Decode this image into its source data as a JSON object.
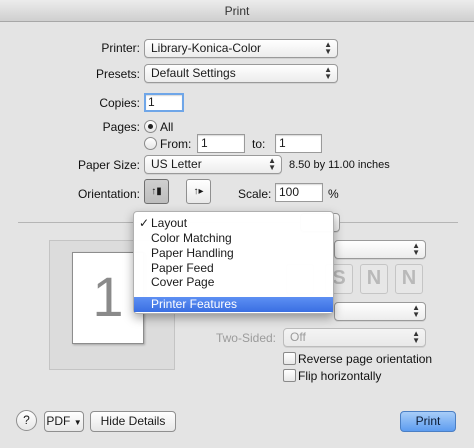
{
  "window": {
    "title": "Print"
  },
  "printer": {
    "label": "Printer:",
    "value": "Library-Konica-Color"
  },
  "presets": {
    "label": "Presets:",
    "value": "Default Settings"
  },
  "copies": {
    "label": "Copies:",
    "value": "1"
  },
  "pages": {
    "label": "Pages:",
    "all_label": "All",
    "from_label": "From:",
    "from_value": "1",
    "to_label": "to:",
    "to_value": "1"
  },
  "paper_size": {
    "label": "Paper Size:",
    "value": "US Letter",
    "dimensions": "8.50 by 11.00 inches"
  },
  "orientation": {
    "label": "Orientation:",
    "portrait_glyph": "↑▮",
    "landscape_glyph": "↑▸"
  },
  "scale": {
    "label": "Scale:",
    "value": "100",
    "unit": "%"
  },
  "preview": {
    "page_number": "1"
  },
  "section_menu": {
    "items": [
      {
        "label": "Layout",
        "checked": "✓"
      },
      {
        "label": "Color Matching"
      },
      {
        "label": "Paper Handling"
      },
      {
        "label": "Paper Feed"
      },
      {
        "label": "Cover Page"
      },
      {
        "label": "Printer Features"
      }
    ]
  },
  "layout": {
    "two_sided_label": "Two-Sided:",
    "two_sided_value": "Off",
    "reverse_label": "Reverse page orientation",
    "flip_label": "Flip horizontally",
    "ghost_glyphs": [
      "S",
      "N",
      "N"
    ]
  },
  "footer": {
    "help": "?",
    "pdf": "PDF",
    "hide_details": "Hide Details",
    "print": "Print"
  }
}
